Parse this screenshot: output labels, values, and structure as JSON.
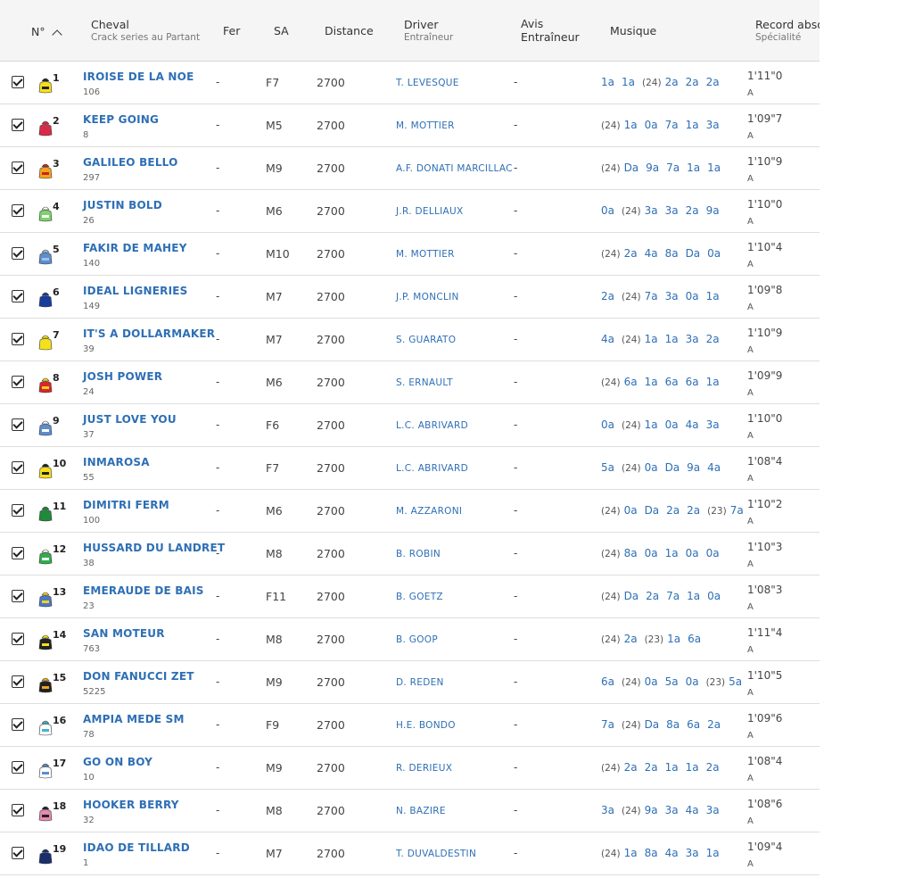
{
  "header": {
    "num": "N°",
    "cheval": "Cheval",
    "cheval_sub": "Crack series au Partant",
    "fer": "Fer",
    "sa": "SA",
    "distance": "Distance",
    "driver": "Driver",
    "driver_sub": "Entraîneur",
    "avis_1": "Avis",
    "avis_2": "Entraîneur",
    "musique": "Musique",
    "record": "Record absolu",
    "record_sub": "Spécialité"
  },
  "colors": {
    "link": "#2e6fb5",
    "header_bg": "#f5f5f5"
  },
  "rows": [
    {
      "num": "1",
      "name": "IROISE DE LA NOE",
      "gain": "106",
      "fer": "-",
      "sa": "F7",
      "distance": "2700",
      "driver": "T. LEVESQUE",
      "avis": "-",
      "record": "1'11\"0",
      "spec": "A",
      "silk": [
        "#f5e11a",
        "#222222"
      ],
      "musique": [
        "1a",
        "1a",
        "(24)",
        "2a",
        "2a",
        "2a"
      ]
    },
    {
      "num": "2",
      "name": "KEEP GOING",
      "gain": "8",
      "fer": "-",
      "sa": "M5",
      "distance": "2700",
      "driver": "M. MOTTIER",
      "avis": "-",
      "record": "1'09\"7",
      "spec": "A",
      "silk": [
        "#d92a4a",
        "#d92a4a"
      ],
      "musique": [
        "(24)",
        "1a",
        "0a",
        "7a",
        "1a",
        "3a"
      ]
    },
    {
      "num": "3",
      "name": "GALILEO BELLO",
      "gain": "297",
      "fer": "-",
      "sa": "M9",
      "distance": "2700",
      "driver": "A.F. DONATI MARCILLAC",
      "avis": "-",
      "record": "1'10\"9",
      "spec": "A",
      "silk": [
        "#f2a51a",
        "#cc2222"
      ],
      "musique": [
        "(24)",
        "Da",
        "9a",
        "7a",
        "1a",
        "1a"
      ]
    },
    {
      "num": "4",
      "name": "JUSTIN BOLD",
      "gain": "26",
      "fer": "-",
      "sa": "M6",
      "distance": "2700",
      "driver": "J.R. DELLIAUX",
      "avis": "-",
      "record": "1'10\"0",
      "spec": "A",
      "silk": [
        "#7bd36a",
        "#ffffff"
      ],
      "musique": [
        "0a",
        "(24)",
        "3a",
        "3a",
        "2a",
        "9a"
      ]
    },
    {
      "num": "5",
      "name": "FAKIR DE MAHEY",
      "gain": "140",
      "fer": "-",
      "sa": "M10",
      "distance": "2700",
      "driver": "M. MOTTIER",
      "avis": "-",
      "record": "1'10\"4",
      "spec": "A",
      "silk": [
        "#5b8ecf",
        "#9ec3ea"
      ],
      "musique": [
        "(24)",
        "2a",
        "4a",
        "8a",
        "Da",
        "0a"
      ]
    },
    {
      "num": "6",
      "name": "IDEAL LIGNERIES",
      "gain": "149",
      "fer": "-",
      "sa": "M7",
      "distance": "2700",
      "driver": "J.P. MONCLIN",
      "avis": "-",
      "record": "1'09\"8",
      "spec": "A",
      "silk": [
        "#1a3c9a",
        "#1a3c9a"
      ],
      "musique": [
        "2a",
        "(24)",
        "7a",
        "3a",
        "0a",
        "1a"
      ]
    },
    {
      "num": "7",
      "name": "IT'S A DOLLARMAKER",
      "gain": "39",
      "fer": "-",
      "sa": "M7",
      "distance": "2700",
      "driver": "S. GUARATO",
      "avis": "-",
      "record": "1'10\"9",
      "spec": "A",
      "silk": [
        "#f5e11a",
        "#f5e11a"
      ],
      "musique": [
        "4a",
        "(24)",
        "1a",
        "1a",
        "3a",
        "2a"
      ]
    },
    {
      "num": "8",
      "name": "JOSH POWER",
      "gain": "24",
      "fer": "-",
      "sa": "M6",
      "distance": "2700",
      "driver": "S. ERNAULT",
      "avis": "-",
      "record": "1'09\"9",
      "spec": "A",
      "silk": [
        "#d9262a",
        "#f5d21a"
      ],
      "musique": [
        "(24)",
        "6a",
        "1a",
        "6a",
        "6a",
        "1a"
      ]
    },
    {
      "num": "9",
      "name": "JUST LOVE YOU",
      "gain": "37",
      "fer": "-",
      "sa": "F6",
      "distance": "2700",
      "driver": "L.C. ABRIVARD",
      "avis": "-",
      "record": "1'10\"0",
      "spec": "A",
      "silk": [
        "#5b8ecf",
        "#ffffff"
      ],
      "musique": [
        "0a",
        "(24)",
        "1a",
        "0a",
        "4a",
        "3a"
      ]
    },
    {
      "num": "10",
      "name": "INMAROSA",
      "gain": "55",
      "fer": "-",
      "sa": "F7",
      "distance": "2700",
      "driver": "L.C. ABRIVARD",
      "avis": "-",
      "record": "1'08\"4",
      "spec": "A",
      "silk": [
        "#f5e11a",
        "#222222"
      ],
      "musique": [
        "5a",
        "(24)",
        "0a",
        "Da",
        "9a",
        "4a"
      ]
    },
    {
      "num": "11",
      "name": "DIMITRI FERM",
      "gain": "100",
      "fer": "-",
      "sa": "M6",
      "distance": "2700",
      "driver": "M. AZZARONI",
      "avis": "-",
      "record": "1'10\"2",
      "spec": "A",
      "silk": [
        "#1f8a3a",
        "#1f8a3a"
      ],
      "musique": [
        "(24)",
        "0a",
        "Da",
        "2a",
        "2a",
        "(23)",
        "7a"
      ]
    },
    {
      "num": "12",
      "name": "HUSSARD DU LANDRET",
      "gain": "38",
      "fer": "-",
      "sa": "M8",
      "distance": "2700",
      "driver": "B. ROBIN",
      "avis": "-",
      "record": "1'10\"3",
      "spec": "A",
      "silk": [
        "#2fae4a",
        "#ffffff"
      ],
      "musique": [
        "(24)",
        "8a",
        "0a",
        "1a",
        "0a",
        "0a"
      ]
    },
    {
      "num": "13",
      "name": "EMERAUDE DE BAIS",
      "gain": "23",
      "fer": "-",
      "sa": "F11",
      "distance": "2700",
      "driver": "B. GOETZ",
      "avis": "-",
      "record": "1'08\"3",
      "spec": "A",
      "silk": [
        "#4a79c4",
        "#f5d21a"
      ],
      "musique": [
        "(24)",
        "Da",
        "2a",
        "7a",
        "1a",
        "0a"
      ]
    },
    {
      "num": "14",
      "name": "SAN MOTEUR",
      "gain": "763",
      "fer": "-",
      "sa": "M8",
      "distance": "2700",
      "driver": "B. GOOP",
      "avis": "-",
      "record": "1'11\"4",
      "spec": "A",
      "silk": [
        "#222222",
        "#f5e11a"
      ],
      "musique": [
        "(24)",
        "2a",
        "(23)",
        "1a",
        "6a"
      ]
    },
    {
      "num": "15",
      "name": "DON FANUCCI ZET",
      "gain": "5225",
      "fer": "-",
      "sa": "M9",
      "distance": "2700",
      "driver": "D. REDEN",
      "avis": "-",
      "record": "1'10\"5",
      "spec": "A",
      "silk": [
        "#222222",
        "#f2a51a"
      ],
      "musique": [
        "6a",
        "(24)",
        "0a",
        "5a",
        "0a",
        "(23)",
        "5a"
      ]
    },
    {
      "num": "16",
      "name": "AMPIA MEDE SM",
      "gain": "78",
      "fer": "-",
      "sa": "F9",
      "distance": "2700",
      "driver": "H.E. BONDO",
      "avis": "-",
      "record": "1'09\"6",
      "spec": "A",
      "silk": [
        "#ffffff",
        "#3fb7cf"
      ],
      "musique": [
        "7a",
        "(24)",
        "Da",
        "8a",
        "6a",
        "2a"
      ]
    },
    {
      "num": "17",
      "name": "GO ON BOY",
      "gain": "10",
      "fer": "-",
      "sa": "M9",
      "distance": "2700",
      "driver": "R. DERIEUX",
      "avis": "-",
      "record": "1'08\"4",
      "spec": "A",
      "silk": [
        "#ffffff",
        "#5b8ecf"
      ],
      "musique": [
        "(24)",
        "2a",
        "2a",
        "1a",
        "1a",
        "2a"
      ]
    },
    {
      "num": "18",
      "name": "HOOKER BERRY",
      "gain": "32",
      "fer": "-",
      "sa": "M8",
      "distance": "2700",
      "driver": "N. BAZIRE",
      "avis": "-",
      "record": "1'08\"6",
      "spec": "A",
      "silk": [
        "#e58ab0",
        "#222222"
      ],
      "musique": [
        "3a",
        "(24)",
        "9a",
        "3a",
        "4a",
        "3a"
      ]
    },
    {
      "num": "19",
      "name": "IDAO DE TILLARD",
      "gain": "1",
      "fer": "-",
      "sa": "M7",
      "distance": "2700",
      "driver": "T. DUVALDESTIN",
      "avis": "-",
      "record": "1'09\"4",
      "spec": "A",
      "silk": [
        "#1a2f6a",
        "#1a2f6a"
      ],
      "musique": [
        "(24)",
        "1a",
        "8a",
        "4a",
        "3a",
        "1a"
      ]
    }
  ]
}
